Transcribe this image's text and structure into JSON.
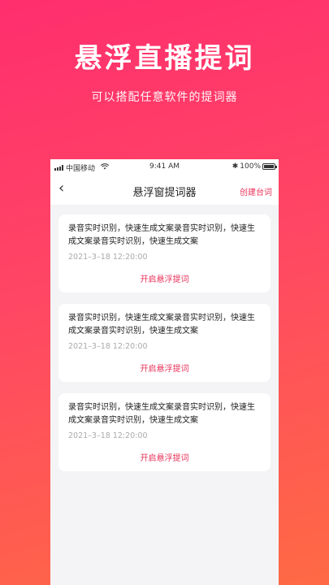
{
  "hero": {
    "title": "悬浮直播提词",
    "subtitle": "可以搭配任意软件的提词器"
  },
  "statusbar": {
    "carrier": "中国移动",
    "wifi_icon": "wifi-icon",
    "time": "9:41 AM",
    "bluetooth": "✱",
    "battery": "100%"
  },
  "navbar": {
    "back_icon": "‹",
    "title": "悬浮窗提词器",
    "action": "创建台词"
  },
  "cards": [
    {
      "text": "录音实时识别，快速生成文案录音实时识别，快速生成文案录音实时识别，快速生成文案",
      "date": "2021–3–18 12:20:00",
      "action": "开启悬浮提词"
    },
    {
      "text": "录音实时识别，快速生成文案录音实时识别，快速生成文案录音实时识别，快速生成文案",
      "date": "2021–3–18 12:20:00",
      "action": "开启悬浮提词"
    },
    {
      "text": "录音实时识别，快速生成文案录音实时识别，快速生成文案录音实时识别，快速生成文案",
      "date": "2021–3–18 12:20:00",
      "action": "开启悬浮提词"
    }
  ],
  "colors": {
    "accent": "#e8325a",
    "gradient_top": "#ff2e6e",
    "gradient_bottom": "#ff6a44"
  }
}
